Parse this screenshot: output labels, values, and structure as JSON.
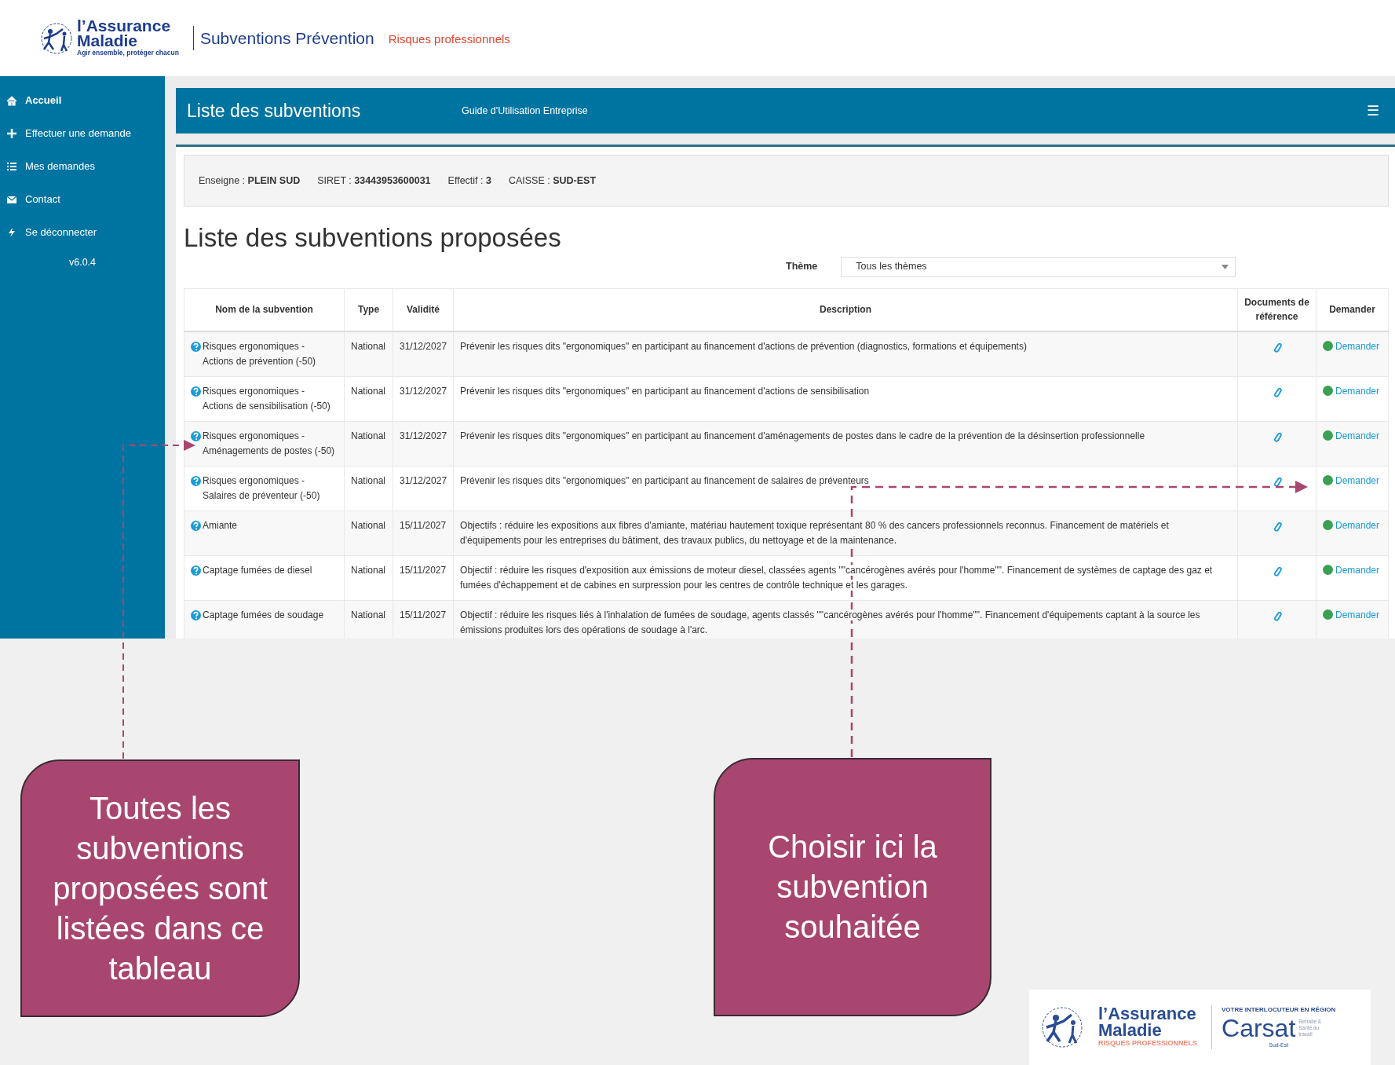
{
  "header": {
    "logo": {
      "line_1": "l’Assurance",
      "line_2": "Maladie",
      "tagline": "Agir ensemble, protéger chacun"
    },
    "app_title": "Subventions Prévention",
    "app_subtitle": "Risques professionnels"
  },
  "sidebar": {
    "items": [
      {
        "label": "Accueil",
        "kind": "home",
        "selected": true
      },
      {
        "label": "Effectuer une demande",
        "kind": "create",
        "selected": false
      },
      {
        "label": "Mes demandes",
        "kind": "list",
        "selected": false
      },
      {
        "label": "Contact",
        "kind": "contact",
        "selected": false
      },
      {
        "label": "Se déconnecter",
        "kind": "logout",
        "selected": false
      }
    ],
    "version": "v6.0.4"
  },
  "page_bar": {
    "title": "Liste des subventions",
    "guide_link": "Guide d'Utilisation Entreprise",
    "menu_icon": "☰"
  },
  "company_info": [
    {
      "label": "Enseigne :",
      "value": "PLEIN SUD"
    },
    {
      "label": "SIRET :",
      "value": "33443953600031"
    },
    {
      "label": "Effectif :",
      "value": "3"
    },
    {
      "label": "CAISSE :",
      "value": "SUD-EST"
    }
  ],
  "heading": "Liste des subventions proposées",
  "filter": {
    "label": "Thème",
    "value": "Tous les thèmes"
  },
  "table": {
    "columns": [
      "Nom de la subvention",
      "Type",
      "Validité",
      "Description",
      "Documents de référence",
      "Demander"
    ],
    "rows": [
      {
        "name": "Risques ergonomiques - Actions de prévention (-50)",
        "type": "National",
        "validity": "31/12/2027",
        "description": "Prévenir les risques dits \"ergonomiques\" en participant au financement d'actions de prévention (diagnostics, formations et équipements)",
        "action": "Demander"
      },
      {
        "name": "Risques ergonomiques - Actions de sensibilisation (-50)",
        "type": "National",
        "validity": "31/12/2027",
        "description": "Prévenir les risques dits \"ergonomiques\" en participant au financement d'actions de sensibilisation",
        "action": "Demander"
      },
      {
        "name": "Risques ergonomiques - Aménagements de postes (-50)",
        "type": "National",
        "validity": "31/12/2027",
        "description": "Prévenir les risques dits \"ergonomiques\" en participant au financement d'aménagements de postes dans le cadre de la prévention de la désinsertion professionnelle",
        "action": "Demander"
      },
      {
        "name": "Risques ergonomiques - Salaires de préventeur (-50)",
        "type": "National",
        "validity": "31/12/2027",
        "description": "Prévenir les risques dits \"ergonomiques\" en participant au financement de salaires de préventeurs",
        "action": "Demander"
      },
      {
        "name": "Amiante",
        "type": "National",
        "validity": "15/11/2027",
        "description": "Objectifs : réduire les expositions aux fibres d'amiante, matériau hautement toxique représentant 80 % des cancers professionnels reconnus. Financement de matériels et d'équipements pour les entreprises du bâtiment, des travaux publics, du nettoyage et de la maintenance.",
        "action": "Demander"
      },
      {
        "name": "Captage fumées de diesel",
        "type": "National",
        "validity": "15/11/2027",
        "description": "Objectif : réduire les risques d'exposition aux émissions de moteur diesel, classées agents \"\"cancérogènes avérés pour l'homme\"\". Financement de systèmes de captage des gaz et fumées d'échappement et de cabines en surpression pour les centres de contrôle technique et les garages.",
        "action": "Demander"
      },
      {
        "name": "Captage fumées de soudage",
        "type": "National",
        "validity": "15/11/2027",
        "description": "Objectif : réduire les risques liés à l'inhalation de fumées de soudage, agents classés \"\"cancérogènes avérés pour l'homme\"\". Financement d'équipements captant à la source les émissions produites lors des opérations de soudage à l'arc.",
        "action": "Demander"
      }
    ]
  },
  "callouts": [
    {
      "text": "Toutes les subventions proposées sont listées dans ce tableau"
    },
    {
      "text": "Choisir ici la subvention souhaitée"
    }
  ],
  "footer_logo": {
    "assurance_line_1": "l’Assurance",
    "assurance_line_2": "Maladie",
    "assurance_tagline": "RISQUES PROFESSIONNELS",
    "carsat_kicker": "VOTRE INTERLOCUTEUR EN RÉGION",
    "carsat_name": "Carsat",
    "carsat_side": "Retraite & Santé au travail",
    "carsat_region": "Sud-Est"
  }
}
